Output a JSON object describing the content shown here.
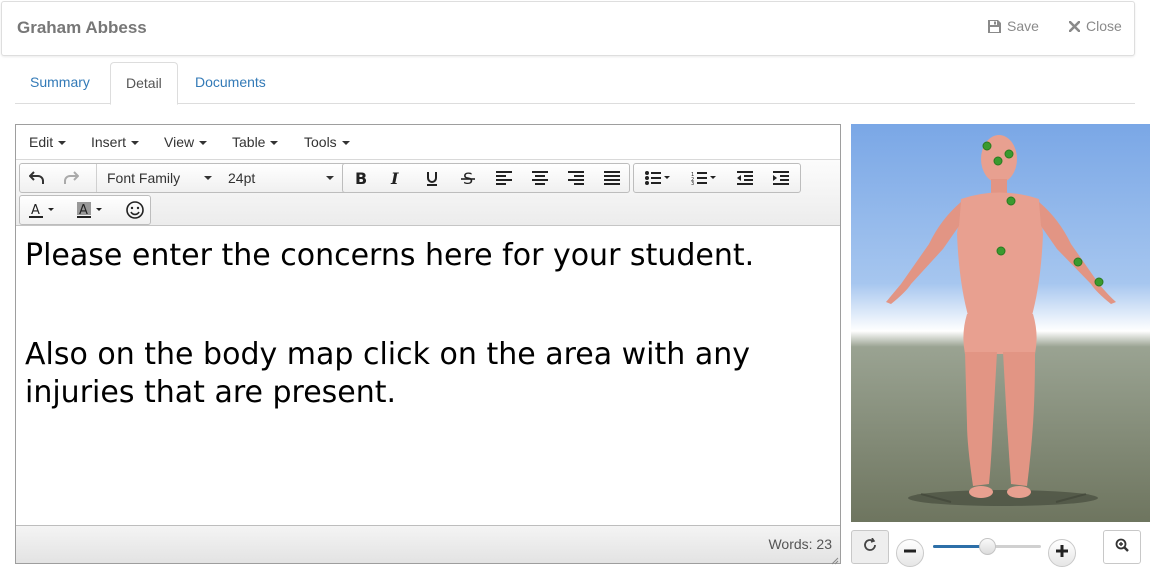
{
  "header": {
    "title": "Graham Abbess",
    "save_label": "Save",
    "close_label": "Close"
  },
  "tabs": [
    {
      "label": "Summary",
      "active": false
    },
    {
      "label": "Detail",
      "active": true
    },
    {
      "label": "Documents",
      "active": false
    }
  ],
  "editor": {
    "menu": [
      "Edit",
      "Insert",
      "View",
      "Table",
      "Tools"
    ],
    "font_family": "Font Family",
    "font_size": "24pt",
    "content": {
      "line1": "Please enter the concerns here for your student.",
      "line2a": "Also on the body map click on the area with any",
      "line2b": "injuries that are present."
    },
    "word_count": "Words: 23"
  },
  "body_map": {
    "zoom_level": 0.5
  },
  "colors": {
    "link": "#337ab7",
    "slider": "#2d6fa8",
    "marker": "#3a9a2e",
    "skin": "#e8a090"
  }
}
